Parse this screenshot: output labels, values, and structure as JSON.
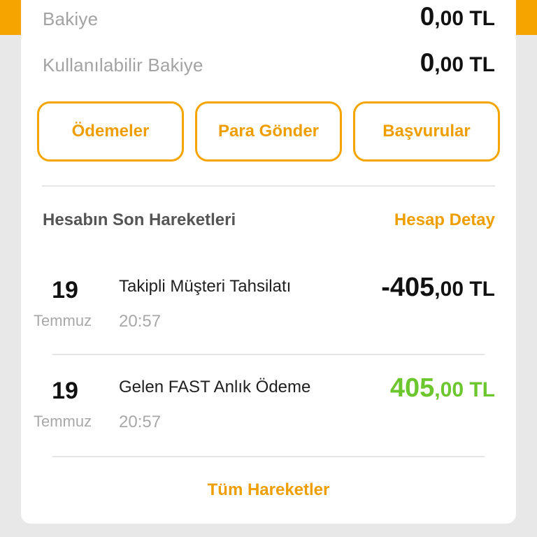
{
  "balances": [
    {
      "label": "Bakiye",
      "amount_int": "0",
      "amount_frac": ",00 TL"
    },
    {
      "label": "Kullanılabilir Bakiye",
      "amount_int": "0",
      "amount_frac": ",00 TL"
    }
  ],
  "actions": {
    "payments": "Ödemeler",
    "send_money": "Para Gönder",
    "applications": "Başvurular"
  },
  "recent": {
    "title": "Hesabın Son Hareketleri",
    "detail_link": "Hesap Detay",
    "transactions": [
      {
        "day": "19",
        "month": "Temmuz",
        "title": "Takipli Müşteri Tahsilatı",
        "time": "20:57",
        "amount_int": "-405",
        "amount_frac": ",00 TL"
      },
      {
        "day": "19",
        "month": "Temmuz",
        "title": "Gelen FAST Anlık Ödeme",
        "time": "20:57",
        "amount_int": "405",
        "amount_frac": ",00 TL"
      }
    ],
    "all_link": "Tüm Hareketler"
  },
  "colors": {
    "accent": "#f5a400",
    "accent_text": "#ef9e00",
    "positive": "#6cc62d",
    "text_primary": "#111111",
    "text_muted": "#a3a3a3",
    "background": "#e8e8e8"
  }
}
